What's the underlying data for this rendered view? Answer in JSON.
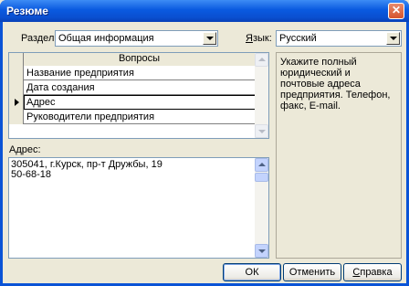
{
  "window": {
    "title": "Резюме",
    "close_glyph": "✕"
  },
  "section": {
    "label": "Раздел",
    "value": "Общая информация"
  },
  "language": {
    "label_first": "Я",
    "label_rest": "зык:",
    "value": "Русский"
  },
  "grid": {
    "header": "Вопросы",
    "rows": [
      {
        "text": "Название предприятия",
        "selected": false
      },
      {
        "text": "Дата создания",
        "selected": false
      },
      {
        "text": "Адрес",
        "selected": true
      },
      {
        "text": "Руководители предприятия",
        "selected": false
      }
    ]
  },
  "hint_text": "Укажите полный юридический и почтовые адреса предприятия. Телефон, факс, E-mail.",
  "answer": {
    "label": "Адрес:",
    "lines": [
      "305041, г.Курск, пр-т Дружбы, 19",
      "50-68-18"
    ]
  },
  "buttons": {
    "ok": "ОК",
    "cancel": "Отменить",
    "help_first": "С",
    "help_rest": "правка"
  }
}
